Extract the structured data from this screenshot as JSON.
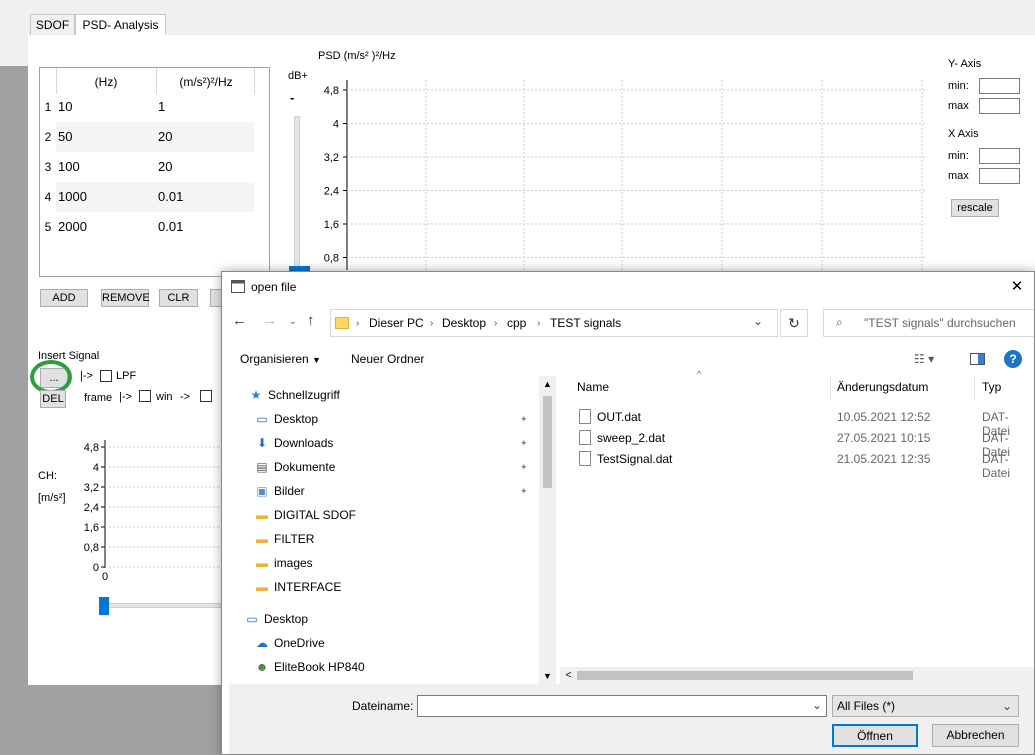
{
  "tabs": {
    "sdof": "SDOF",
    "psd": "PSD- Analysis"
  },
  "table": {
    "col_hz": "(Hz)",
    "col_psd": "(m/s²)²/Hz",
    "rows": [
      {
        "idx": "1",
        "hz": "10",
        "psd": "1"
      },
      {
        "idx": "2",
        "hz": "50",
        "psd": "20"
      },
      {
        "idx": "3",
        "hz": "100",
        "psd": "20"
      },
      {
        "idx": "4",
        "hz": "1000",
        "psd": "0.01"
      },
      {
        "idx": "5",
        "hz": "2000",
        "psd": "0.01"
      }
    ]
  },
  "buttons": {
    "add": "ADD",
    "remove": "REMOVE",
    "clr": "CLR",
    "browse": "...",
    "del": "DEL",
    "rescale": "rescale"
  },
  "signal": {
    "insert": "Insert Signal",
    "arrow": "|->",
    "lpf": "LPF",
    "frame": "frame",
    "arrow2": "|->",
    "win": "win",
    "arrow3": "->"
  },
  "psd_chart": {
    "title": "PSD (m/s² )²/Hz",
    "db_label": "dB+",
    "db_minus": "-",
    "y_ticks": [
      "4,8",
      "4",
      "3,2",
      "2,4",
      "1,6",
      "0,8"
    ]
  },
  "axis_panel": {
    "y_title": "Y- Axis",
    "x_title": "X Axis",
    "min": "min:",
    "max": "max"
  },
  "small_chart": {
    "ch_label": "CH:",
    "unit_label": "[m/s²]",
    "y_ticks": [
      "4,8",
      "4",
      "3,2",
      "2,4",
      "1,6",
      "0,8",
      "0"
    ]
  },
  "colors": {
    "accent": "#0078d7",
    "highlight_circle": "#2e9e3e"
  },
  "dialog": {
    "title": "open file",
    "close": "✕",
    "breadcrumb": [
      "Dieser PC",
      "Desktop",
      "cpp",
      "TEST signals"
    ],
    "search_placeholder": "\"TEST signals\" durchsuchen",
    "organize": "Organisieren",
    "new_folder": "Neuer Ordner",
    "nav": [
      {
        "label": "Schnellzugriff",
        "icon": "star-icon"
      },
      {
        "label": "Desktop",
        "icon": "desktop-icon",
        "pinned": true
      },
      {
        "label": "Downloads",
        "icon": "download-icon",
        "pinned": true
      },
      {
        "label": "Dokumente",
        "icon": "document-icon",
        "pinned": true
      },
      {
        "label": "Bilder",
        "icon": "picture-icon",
        "pinned": true
      },
      {
        "label": "DIGITAL SDOF",
        "icon": "folder-icon"
      },
      {
        "label": "FILTER",
        "icon": "folder-icon"
      },
      {
        "label": "images",
        "icon": "folder-icon"
      },
      {
        "label": "INTERFACE",
        "icon": "folder-icon"
      },
      {
        "label": "Desktop",
        "icon": "desktop-icon"
      },
      {
        "label": "OneDrive",
        "icon": "cloud-icon"
      },
      {
        "label": "EliteBook HP840",
        "icon": "user-icon"
      }
    ],
    "columns": {
      "name": "Name",
      "date": "Änderungsdatum",
      "type": "Typ"
    },
    "files": [
      {
        "name": "OUT.dat",
        "date": "10.05.2021 12:52",
        "type": "DAT-Datei"
      },
      {
        "name": "sweep_2.dat",
        "date": "27.05.2021 10:15",
        "type": "DAT-Datei"
      },
      {
        "name": "TestSignal.dat",
        "date": "21.05.2021 12:35",
        "type": "DAT-Datei"
      }
    ],
    "filename_label": "Dateiname:",
    "filename_value": "",
    "filter": "All Files (*)",
    "open": "Öffnen",
    "cancel": "Abbrechen"
  }
}
